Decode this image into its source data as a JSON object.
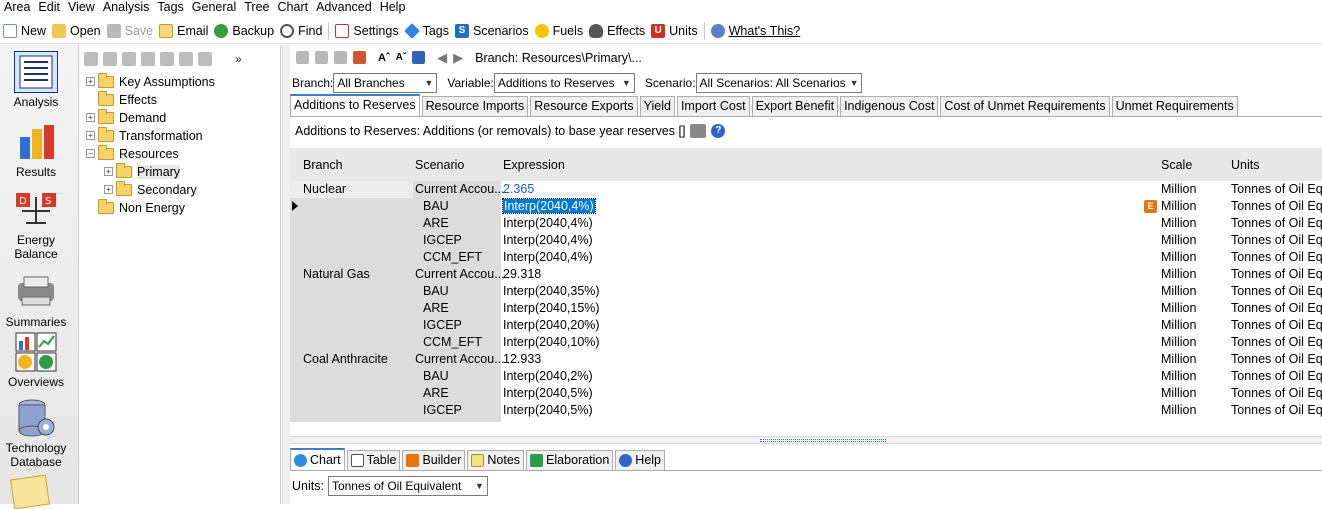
{
  "menu": [
    "Area",
    "Edit",
    "View",
    "Analysis",
    "Tags",
    "General",
    "Tree",
    "Chart",
    "Advanced",
    "Help"
  ],
  "toolbar": {
    "new": "New",
    "open": "Open",
    "save": "Save",
    "email": "Email",
    "backup": "Backup",
    "find": "Find",
    "settings": "Settings",
    "tags": "Tags",
    "scenarios": "Scenarios",
    "fuels": "Fuels",
    "effects": "Effects",
    "units": "Units",
    "whats_this": "What's This?"
  },
  "sidebar": {
    "analysis": "Analysis",
    "results": "Results",
    "energy_balance": "Energy Balance",
    "summaries": "Summaries",
    "overviews": "Overviews",
    "technology_database": "Technology Database"
  },
  "tree": [
    "Key Assumptions",
    "Effects",
    "Demand",
    "Transformation",
    "Resources",
    "Primary",
    "Secondary",
    "Non Energy"
  ],
  "breadcrumb": "Branch: Resources\\Primary\\...",
  "filters": {
    "branch_label": "Branch:",
    "branch_value": "All Branches",
    "variable_label": "Variable:",
    "variable_value": "Additions to Reserves",
    "scenario_label": "Scenario:",
    "scenario_value": "All Scenarios: All Scenarios"
  },
  "tabs": [
    "Additions to Reserves",
    "Resource Imports",
    "Resource Exports",
    "Yield",
    "Import Cost",
    "Export Benefit",
    "Indigenous Cost",
    "Cost of Unmet Requirements",
    "Unmet Requirements"
  ],
  "description": "Additions to Reserves: Additions (or removals) to base year reserves []",
  "grid": {
    "headers": {
      "branch": "Branch",
      "scenario": "Scenario",
      "expression": "Expression",
      "scale": "Scale",
      "units": "Units"
    },
    "rows": [
      {
        "branch": "Nuclear",
        "scenario": "Current Accou...",
        "expression": "2.365",
        "scale": "Million",
        "units": "Tonnes of Oil Equ"
      },
      {
        "branch": "",
        "scenario": "BAU",
        "expression": "Interp(2040,4%)",
        "scale": "Million",
        "units": "Tonnes of Oil Equ"
      },
      {
        "branch": "",
        "scenario": "ARE",
        "expression": "Interp(2040,4%)",
        "scale": "Million",
        "units": "Tonnes of Oil Equ"
      },
      {
        "branch": "",
        "scenario": "IGCEP",
        "expression": "Interp(2040,4%)",
        "scale": "Million",
        "units": "Tonnes of Oil Equ"
      },
      {
        "branch": "",
        "scenario": "CCM_EFT",
        "expression": "Interp(2040,4%)",
        "scale": "Million",
        "units": "Tonnes of Oil Equ"
      },
      {
        "branch": "Natural Gas",
        "scenario": "Current Accou...",
        "expression": "29.318",
        "scale": "Million",
        "units": "Tonnes of Oil Equ"
      },
      {
        "branch": "",
        "scenario": "BAU",
        "expression": "Interp(2040,35%)",
        "scale": "Million",
        "units": "Tonnes of Oil Equ"
      },
      {
        "branch": "",
        "scenario": "ARE",
        "expression": "Interp(2040,15%)",
        "scale": "Million",
        "units": "Tonnes of Oil Equ"
      },
      {
        "branch": "",
        "scenario": "IGCEP",
        "expression": "Interp(2040,20%)",
        "scale": "Million",
        "units": "Tonnes of Oil Equ"
      },
      {
        "branch": "",
        "scenario": "CCM_EFT",
        "expression": "Interp(2040,10%)",
        "scale": "Million",
        "units": "Tonnes of Oil Equ"
      },
      {
        "branch": "Coal Anthracite",
        "scenario": "Current Accou...",
        "expression": "12.933",
        "scale": "Million",
        "units": "Tonnes of Oil Equ"
      },
      {
        "branch": "",
        "scenario": "BAU",
        "expression": "Interp(2040,2%)",
        "scale": "Million",
        "units": "Tonnes of Oil Equ"
      },
      {
        "branch": "",
        "scenario": "ARE",
        "expression": "Interp(2040,5%)",
        "scale": "Million",
        "units": "Tonnes of Oil Equ"
      },
      {
        "branch": "",
        "scenario": "IGCEP",
        "expression": "Interp(2040,5%)",
        "scale": "Million",
        "units": "Tonnes of Oil Equ"
      }
    ],
    "e_badge": "E"
  },
  "bottom_tabs": [
    "Chart",
    "Table",
    "Builder",
    "Notes",
    "Elaboration",
    "Help"
  ],
  "units_row": {
    "label": "Units:",
    "value": "Tonnes of Oil Equivalent"
  }
}
